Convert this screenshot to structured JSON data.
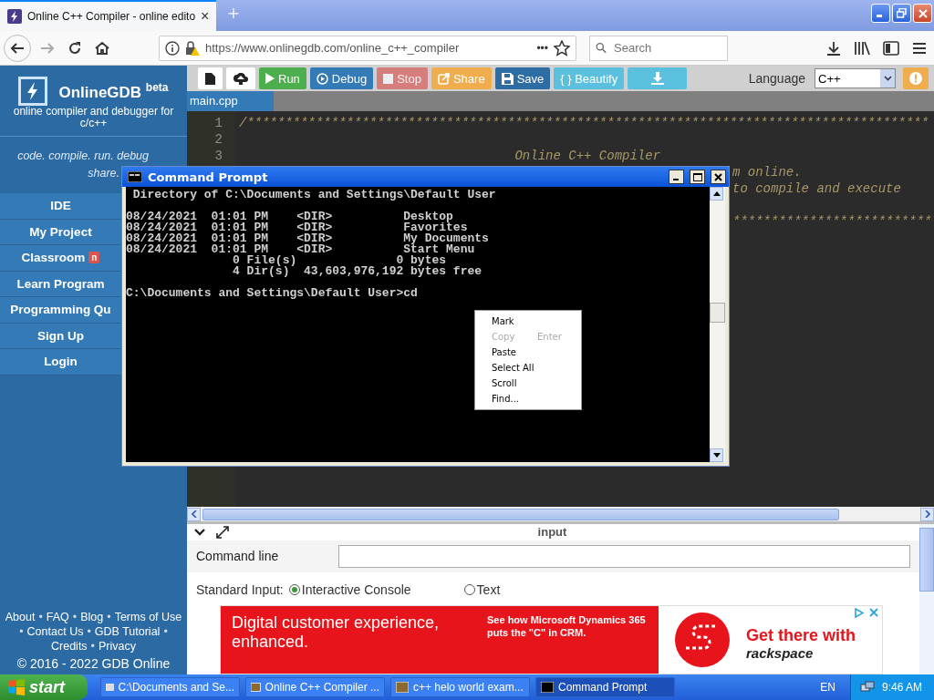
{
  "browser": {
    "tab_title": "Online C++ Compiler - online edito",
    "tab_close": "×",
    "new_tab": "+",
    "url": "https://www.onlinegdb.com/online_c++_compiler",
    "url_menu": "•••",
    "search_placeholder": "Search"
  },
  "sidebar": {
    "brand": "OnlineGDB",
    "brand_badge": "beta",
    "subtitle": "online compiler and debugger for c/c++",
    "tagline": [
      "code. compile. run. debug",
      "share."
    ],
    "items": [
      {
        "label": "IDE"
      },
      {
        "label": "My Project"
      },
      {
        "label": "Classroom",
        "badge": "n"
      },
      {
        "label": "Learn Program"
      },
      {
        "label": "Programming Qu"
      },
      {
        "label": "Sign Up"
      },
      {
        "label": "Login"
      }
    ],
    "footer": [
      [
        {
          "kind": "link",
          "text": "About"
        },
        {
          "kind": "sep",
          "text": "•"
        },
        {
          "kind": "link",
          "text": "FAQ"
        },
        {
          "kind": "sep",
          "text": "•"
        },
        {
          "kind": "link",
          "text": "Blog"
        },
        {
          "kind": "sep",
          "text": "•"
        },
        {
          "kind": "link",
          "text": "Terms of Use"
        }
      ],
      [
        {
          "kind": "sep",
          "text": "•"
        },
        {
          "kind": "link",
          "text": "Contact Us"
        },
        {
          "kind": "sep",
          "text": "•"
        },
        {
          "kind": "link",
          "text": "GDB Tutorial"
        },
        {
          "kind": "sep",
          "text": "•"
        }
      ],
      [
        {
          "kind": "link",
          "text": "Credits"
        },
        {
          "kind": "sep",
          "text": "•"
        },
        {
          "kind": "link",
          "text": "Privacy"
        }
      ]
    ],
    "copyright": "© 2016 - 2022 GDB Online"
  },
  "toolbar": {
    "buttons": [
      {
        "kind": "file",
        "disabled": false
      },
      {
        "kind": "upload",
        "disabled": false
      },
      {
        "kind": "run",
        "label": "Run",
        "disabled": false
      },
      {
        "kind": "debug",
        "label": "Debug",
        "disabled": false
      },
      {
        "kind": "stop",
        "label": "Stop",
        "disabled": true
      },
      {
        "kind": "share",
        "label": "Share",
        "disabled": false
      },
      {
        "kind": "save",
        "label": "Save",
        "disabled": false
      },
      {
        "kind": "beautify",
        "label": "{ } Beautify",
        "disabled": false
      },
      {
        "kind": "download",
        "disabled": false
      }
    ],
    "language_label": "Language",
    "language": "C++"
  },
  "editor": {
    "tab": "main.cpp",
    "lines": [
      {
        "number": "1",
        "text": "/*****************************************************************************************"
      },
      {
        "number": "2"
      },
      {
        "number": "3",
        "text": "                                    Online C++ Compiler"
      }
    ],
    "right_fragments": [
      "m online.",
      "to compile and execute"
    ],
    "right_rule": "**************************"
  },
  "console": {
    "title": "Command Prompt",
    "blocks": [
      [
        " Directory of C:\\Documents and Settings\\Default User"
      ],
      [
        "08/24/2021  01:01 PM    <DIR>          Desktop",
        "08/24/2021  01:01 PM    <DIR>          Favorites",
        "08/24/2021  01:01 PM    <DIR>          My Documents",
        "08/24/2021  01:01 PM    <DIR>          Start Menu",
        "               0 File(s)              0 bytes",
        "               4 Dir(s)  43,603,976,192 bytes free"
      ],
      [
        "C:\\Documents and Settings\\Default User>cd"
      ]
    ],
    "menu": [
      {
        "label": "Mark",
        "disabled": false
      },
      {
        "label": "Copy",
        "shortcut": "Enter",
        "disabled": true
      },
      {
        "label": "Paste",
        "disabled": false
      },
      {
        "label": "Select All",
        "disabled": false
      },
      {
        "label": "Scroll",
        "disabled": false
      },
      {
        "label": "Find...",
        "disabled": false
      }
    ]
  },
  "input_panel": {
    "title": "input",
    "command_line_label": "Command line",
    "standard_input_label": "Standard Input:",
    "options": [
      {
        "label": "Interactive Console",
        "selected": true
      },
      {
        "label": "Text",
        "selected": false
      }
    ]
  },
  "ad": {
    "headline": "Digital customer experience, enhanced.",
    "subhead": "See how Microsoft Dynamics 365 puts the \"C\" in CRM.",
    "cta": "Get there with",
    "brand": "rackspace"
  },
  "taskbar": {
    "start": "start",
    "tasks": [
      {
        "label": "C:\\Documents and Se...",
        "selected": false
      },
      {
        "label": "Online C++ Compiler ...",
        "selected": false
      },
      {
        "label": "c++ helo world exam...",
        "selected": false
      },
      {
        "label": "Command Prompt",
        "selected": true
      }
    ],
    "language": "EN",
    "clock": "9:46 AM"
  }
}
